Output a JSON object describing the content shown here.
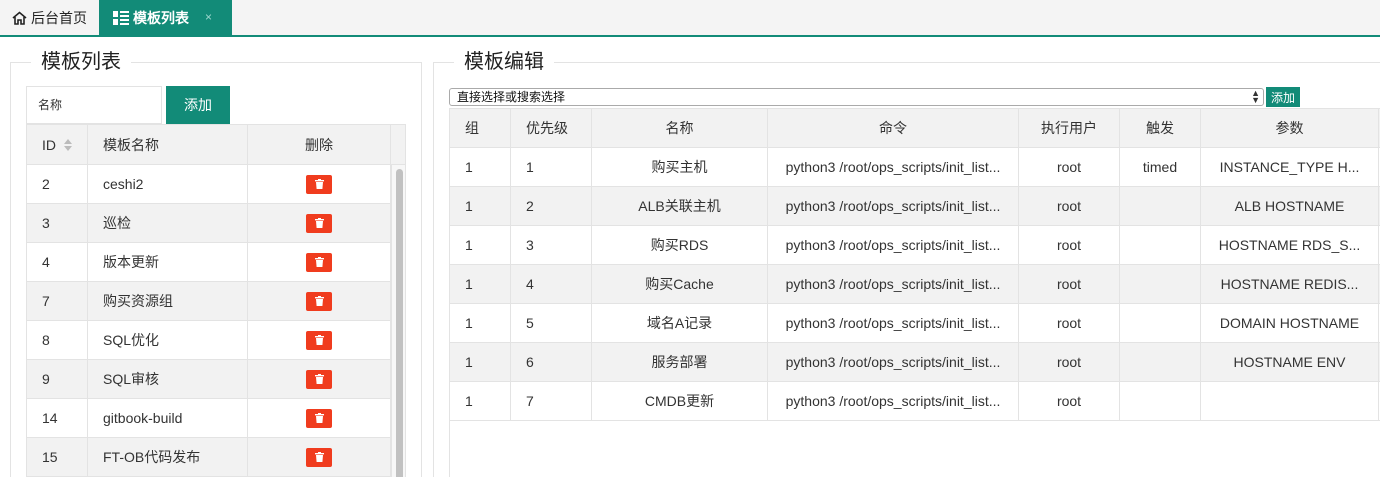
{
  "tabs": [
    {
      "label": "后台首页",
      "icon": "home-icon"
    },
    {
      "label": "模板列表",
      "icon": "list-icon",
      "close": "×"
    }
  ],
  "left": {
    "legend": "模板列表",
    "name_input_placeholder": "名称",
    "add_label": "添加",
    "columns": [
      "ID",
      "模板名称",
      "删除"
    ],
    "rows": [
      {
        "id": "2",
        "name": "ceshi2"
      },
      {
        "id": "3",
        "name": "巡检"
      },
      {
        "id": "4",
        "name": "版本更新"
      },
      {
        "id": "7",
        "name": "购买资源组"
      },
      {
        "id": "8",
        "name": "SQL优化"
      },
      {
        "id": "9",
        "name": "SQL审核"
      },
      {
        "id": "14",
        "name": "gitbook-build"
      },
      {
        "id": "15",
        "name": "FT-OB代码发布"
      }
    ]
  },
  "right": {
    "legend": "模板编辑",
    "select_value": "直接选择或搜索选择",
    "add_label": "添加",
    "columns": [
      "组",
      "优先级",
      "名称",
      "命令",
      "执行用户",
      "触发",
      "参数"
    ],
    "rows": [
      {
        "group": "1",
        "priority": "1",
        "name": "购买主机",
        "command": "python3 /root/ops_scripts/init_list...",
        "user": "root",
        "trigger": "timed",
        "params": "INSTANCE_TYPE H..."
      },
      {
        "group": "1",
        "priority": "2",
        "name": "ALB关联主机",
        "command": "python3 /root/ops_scripts/init_list...",
        "user": "root",
        "trigger": "",
        "params": "ALB HOSTNAME"
      },
      {
        "group": "1",
        "priority": "3",
        "name": "购买RDS",
        "command": "python3 /root/ops_scripts/init_list...",
        "user": "root",
        "trigger": "",
        "params": "HOSTNAME RDS_S..."
      },
      {
        "group": "1",
        "priority": "4",
        "name": "购买Cache",
        "command": "python3 /root/ops_scripts/init_list...",
        "user": "root",
        "trigger": "",
        "params": "HOSTNAME REDIS..."
      },
      {
        "group": "1",
        "priority": "5",
        "name": "域名A记录",
        "command": "python3 /root/ops_scripts/init_list...",
        "user": "root",
        "trigger": "",
        "params": "DOMAIN HOSTNAME"
      },
      {
        "group": "1",
        "priority": "6",
        "name": "服务部署",
        "command": "python3 /root/ops_scripts/init_list...",
        "user": "root",
        "trigger": "",
        "params": "HOSTNAME ENV"
      },
      {
        "group": "1",
        "priority": "7",
        "name": "CMDB更新",
        "command": "python3 /root/ops_scripts/init_list...",
        "user": "root",
        "trigger": "",
        "params": ""
      }
    ]
  },
  "colors": {
    "accent": "#128b78",
    "danger": "#f03c1e",
    "zebra": "#f2f2f2"
  }
}
